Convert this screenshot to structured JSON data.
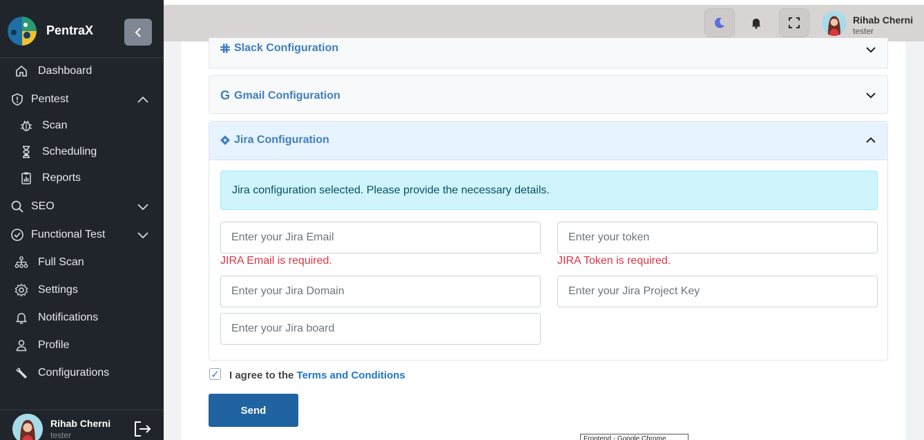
{
  "app": {
    "name": "PentraX"
  },
  "sidebar": {
    "items": [
      {
        "label": "Dashboard",
        "icon": "home-icon"
      },
      {
        "label": "Pentest",
        "icon": "shield-icon",
        "expanded": true
      },
      {
        "label": "Scan",
        "icon": "bug-icon",
        "sub": true
      },
      {
        "label": "Scheduling",
        "icon": "hourglass-icon",
        "sub": true
      },
      {
        "label": "Reports",
        "icon": "clipboard-chart-icon",
        "sub": true
      },
      {
        "label": "SEO",
        "icon": "search-icon",
        "expanded": false
      },
      {
        "label": "Functional Test",
        "icon": "check-circle-icon",
        "expanded": false
      },
      {
        "label": "Full Scan",
        "icon": "hierarchy-icon"
      },
      {
        "label": "Settings",
        "icon": "gear-icon"
      },
      {
        "label": "Notifications",
        "icon": "bell-icon"
      },
      {
        "label": "Profile",
        "icon": "person-icon"
      },
      {
        "label": "Configurations",
        "icon": "wrench-icon"
      }
    ],
    "user": {
      "name": "Rihab Cherni",
      "role": "tester"
    }
  },
  "topbar": {
    "user": {
      "name": "Rihab Cherni",
      "role": "tester"
    }
  },
  "accordions": {
    "slack": {
      "title": "Slack Configuration",
      "icon": "slack-icon",
      "expanded": false
    },
    "gmail": {
      "title": "Gmail Configuration",
      "icon": "google-icon",
      "expanded": false
    },
    "jira": {
      "title": "Jira Configuration",
      "icon": "jira-diamond-icon",
      "expanded": true
    }
  },
  "jira_form": {
    "alert": "Jira configuration selected. Please provide the necessary details.",
    "email": {
      "placeholder": "Enter your Jira Email",
      "value": "",
      "error": "JIRA Email is required."
    },
    "token": {
      "placeholder": "Enter your token",
      "value": "",
      "error": "JIRA Token is required."
    },
    "domain": {
      "placeholder": "Enter your Jira Domain",
      "value": ""
    },
    "project_key": {
      "placeholder": "Enter your Jira Project Key",
      "value": ""
    },
    "board": {
      "placeholder": "Enter your Jira board",
      "value": ""
    }
  },
  "agreement": {
    "prefix": "I agree to the",
    "link": "Terms and Conditions",
    "checked": true
  },
  "send_label": "Send",
  "taskbar_tooltip": "Frontend - Google Chrome",
  "colors": {
    "sidebar_bg": "#20252c",
    "accent": "#3d7fc0",
    "send": "#1f63a0",
    "error": "#dc3545"
  }
}
